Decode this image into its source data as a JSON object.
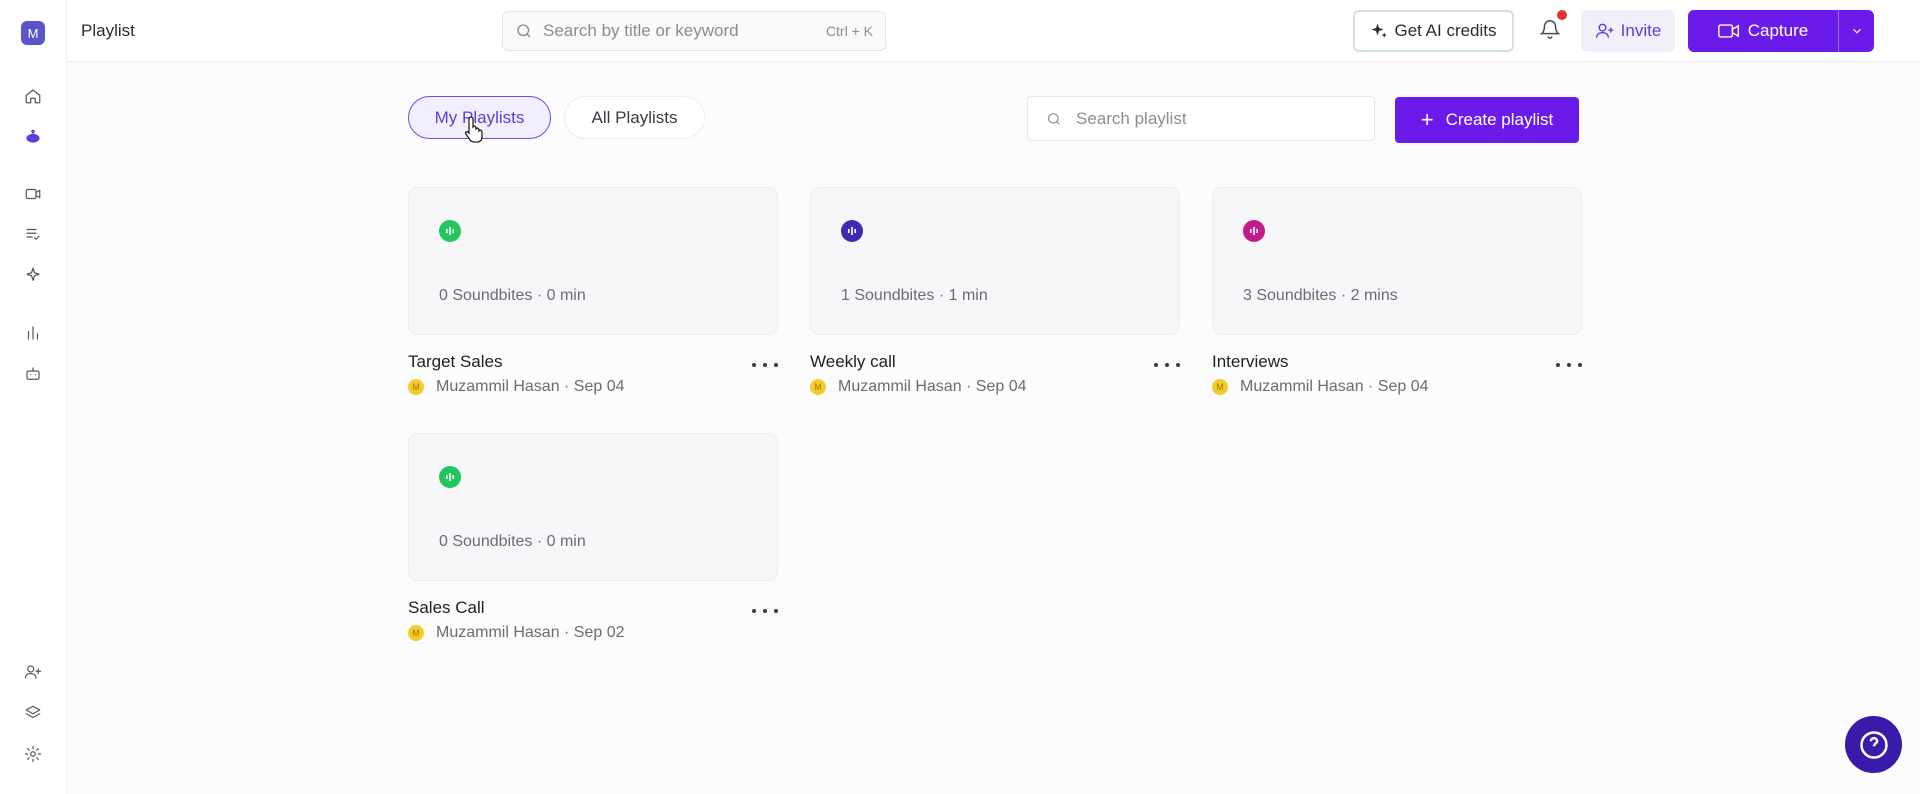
{
  "sidebar": {
    "logo_letter": "M",
    "items": [
      "home-icon",
      "assistant-icon",
      "video-icon",
      "checklist-icon",
      "sparkle-icon",
      "chart-icon",
      "robot-icon"
    ],
    "bottom_items": [
      "add-user-icon",
      "layers-icon",
      "gear-icon"
    ]
  },
  "header": {
    "title": "Playlist",
    "search_placeholder": "Search by title or keyword",
    "search_shortcut": "Ctrl + K",
    "ai_credits_label": "Get AI credits",
    "invite_label": "Invite",
    "capture_label": "Capture"
  },
  "filters": {
    "tabs": [
      {
        "label": "My Playlists",
        "active": true
      },
      {
        "label": "All Playlists",
        "active": false
      }
    ],
    "search_placeholder": "Search playlist",
    "create_label": "Create playlist"
  },
  "colors": {
    "accent": "#6a1bea",
    "badge_green": "#22c55e",
    "badge_indigo": "#3b2bb5",
    "badge_magenta": "#c41a8f"
  },
  "playlists": [
    {
      "title": "Target Sales",
      "meta": "0 Soundbites · 0 min",
      "owner": "Muzammil Hasan · Sep 04",
      "avatar": "M",
      "badge_color": "#22c55e"
    },
    {
      "title": "Weekly call",
      "meta": "1 Soundbites · 1 min",
      "owner": "Muzammil Hasan · Sep 04",
      "avatar": "M",
      "badge_color": "#3b2bb5"
    },
    {
      "title": "Interviews",
      "meta": "3 Soundbites · 2 mins",
      "owner": "Muzammil Hasan · Sep 04",
      "avatar": "M",
      "badge_color": "#c41a8f"
    },
    {
      "title": "Sales Call",
      "meta": "0 Soundbites · 0 min",
      "owner": "Muzammil Hasan · Sep 02",
      "avatar": "M",
      "badge_color": "#22c55e"
    }
  ]
}
